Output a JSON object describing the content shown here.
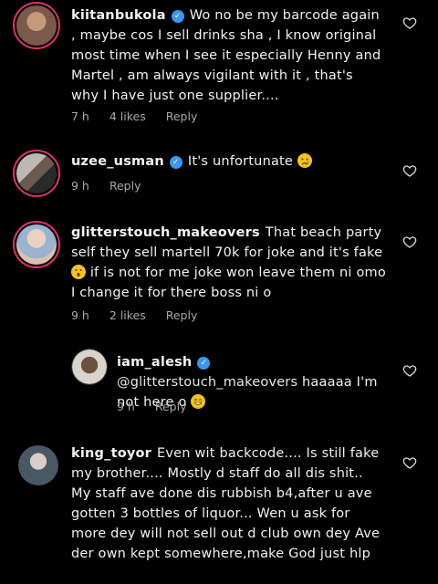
{
  "comments": [
    {
      "username": "kiitanbukola",
      "text": "Wo no be my barcode again , maybe cos I sell drinks sha , I know original most time when I see it especially Henny and Martel , am always vigilant with it , that's why I have just one supplier....",
      "time": "7 h",
      "likes": "4 likes",
      "reply": "Reply",
      "avatar_color": "#7a5a4a"
    },
    {
      "username": "uzee_usman",
      "text": "It's unfortunate",
      "emoji": "sad-face-icon",
      "time": "9 h",
      "reply": "Reply",
      "avatar_color": "#8c8a86"
    },
    {
      "username": "glitterstouch_makeovers",
      "text": "That beach party self they sell martell 70k for joke and it's fake",
      "text2": "if is not for me joke won leave them ni omo I change it for there boss ni o",
      "emoji": "surprised-face-icon",
      "time": "9 h",
      "likes": "2 likes",
      "reply": "Reply",
      "avatar_color": "#c9a48a"
    },
    {
      "username": "iam_alesh",
      "mention": "@glitterstouch_makeovers",
      "text": "haaaaa I'm not here o",
      "emoji": "grin-face-icon",
      "time": "9 h",
      "reply": "Reply",
      "avatar_color": "#5a4a3c"
    },
    {
      "username": "king_toyor",
      "text": "Even wit backcode.... Is still fake my brother.... Mostly d staff do all dis shit.. My staff ave done dis rubbish b4,after u ave gotten 3 bottles of liquor... Wen u ask for more dey will not sell out d club own dey Ave der own kept somewhere,make God just hlp",
      "avatar_color": "#3a4a5a"
    }
  ],
  "colors": {
    "background": "#000000",
    "meta": "#a8a8a8",
    "verified": "#3897f0",
    "story_ring": "#e1306c"
  }
}
